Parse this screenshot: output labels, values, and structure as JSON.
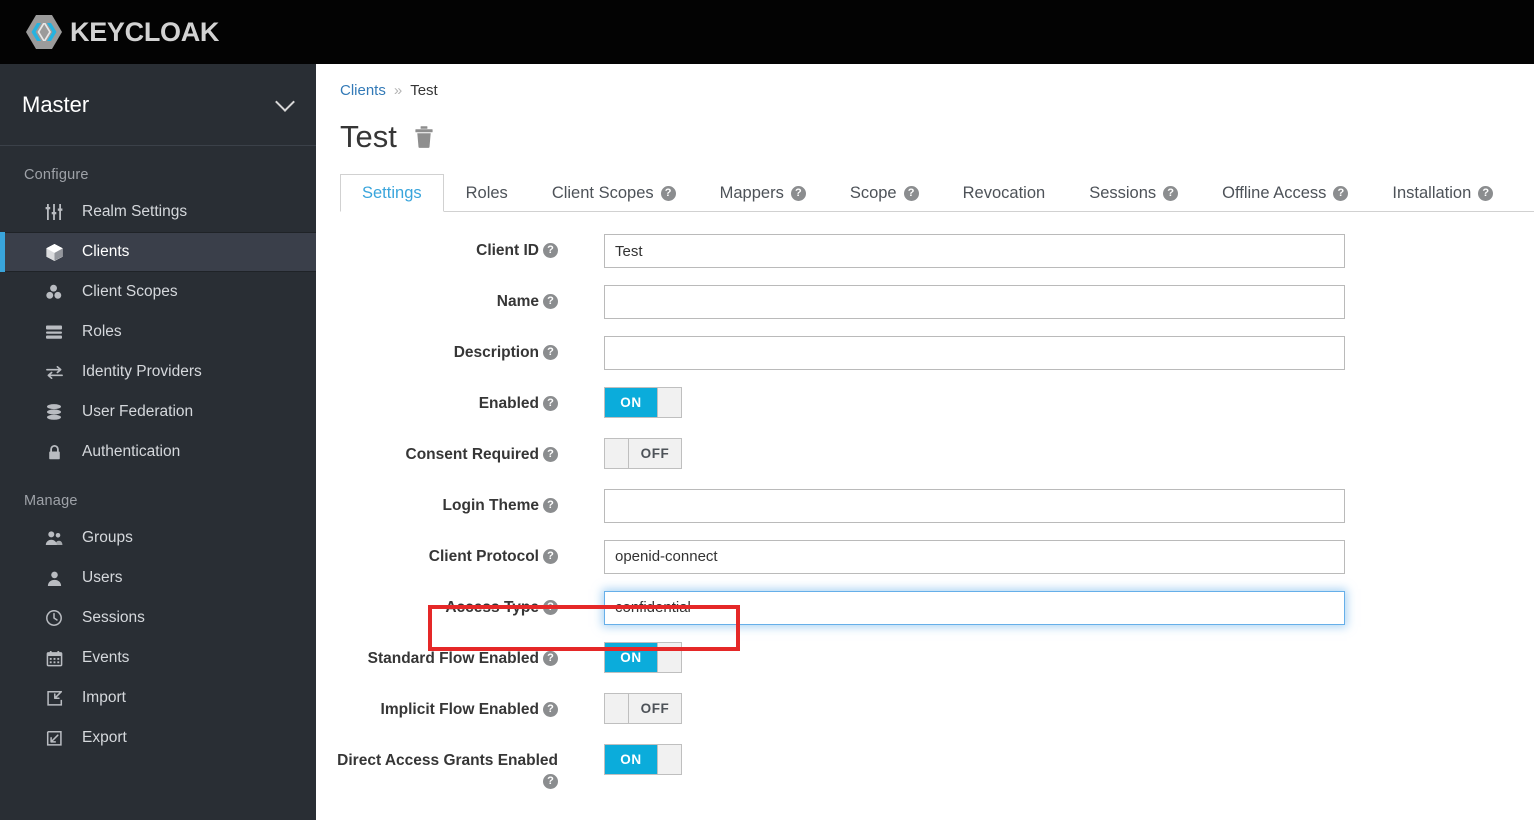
{
  "app": {
    "brand_name": "KEYCLOAK",
    "brand_icon": "keycloak-hexagon-logo",
    "accent_blue": "#39a5dc",
    "toggle_blue": "#0bacdb",
    "annotation_color": "#e52828"
  },
  "sidebar": {
    "realm": {
      "name": "Master",
      "chevron_icon": "chevron-down-icon"
    },
    "groups": [
      {
        "title": "Configure",
        "items": [
          {
            "label": "Realm Settings",
            "icon": "sliders-icon",
            "active": false
          },
          {
            "label": "Clients",
            "icon": "cube-icon",
            "active": true
          },
          {
            "label": "Client Scopes",
            "icon": "blocks-icon",
            "active": false
          },
          {
            "label": "Roles",
            "icon": "list-rows-icon",
            "active": false
          },
          {
            "label": "Identity Providers",
            "icon": "exchange-arrows-icon",
            "active": false
          },
          {
            "label": "User Federation",
            "icon": "database-icon",
            "active": false
          },
          {
            "label": "Authentication",
            "icon": "lock-icon",
            "active": false
          }
        ]
      },
      {
        "title": "Manage",
        "items": [
          {
            "label": "Groups",
            "icon": "users-group-icon",
            "active": false
          },
          {
            "label": "Users",
            "icon": "user-icon",
            "active": false
          },
          {
            "label": "Sessions",
            "icon": "clock-icon",
            "active": false
          },
          {
            "label": "Events",
            "icon": "calendar-icon",
            "active": false
          },
          {
            "label": "Import",
            "icon": "import-arrow-icon",
            "active": false
          },
          {
            "label": "Export",
            "icon": "export-arrow-icon",
            "active": false
          }
        ]
      }
    ]
  },
  "breadcrumb": {
    "parent": "Clients",
    "separator": "»",
    "current": "Test"
  },
  "page": {
    "title": "Test",
    "delete_icon": "trash-icon"
  },
  "tabs": [
    {
      "label": "Settings",
      "help": false,
      "active": true
    },
    {
      "label": "Roles",
      "help": false,
      "active": false
    },
    {
      "label": "Client Scopes",
      "help": true,
      "active": false
    },
    {
      "label": "Mappers",
      "help": true,
      "active": false
    },
    {
      "label": "Scope",
      "help": true,
      "active": false
    },
    {
      "label": "Revocation",
      "help": false,
      "active": false
    },
    {
      "label": "Sessions",
      "help": true,
      "active": false
    },
    {
      "label": "Offline Access",
      "help": true,
      "active": false
    },
    {
      "label": "Installation",
      "help": true,
      "active": false
    }
  ],
  "form": {
    "client_id": {
      "label": "Client ID",
      "value": "Test",
      "placeholder": ""
    },
    "name": {
      "label": "Name",
      "value": "",
      "placeholder": ""
    },
    "description": {
      "label": "Description",
      "value": "",
      "placeholder": ""
    },
    "enabled": {
      "label": "Enabled",
      "state": "ON"
    },
    "consent_required": {
      "label": "Consent Required",
      "state": "OFF"
    },
    "login_theme": {
      "label": "Login Theme",
      "value": ""
    },
    "client_protocol": {
      "label": "Client Protocol",
      "value": "openid-connect"
    },
    "access_type": {
      "label": "Access Type",
      "value": "confidential"
    },
    "standard_flow": {
      "label": "Standard Flow Enabled",
      "state": "ON"
    },
    "implicit_flow": {
      "label": "Implicit Flow Enabled",
      "state": "OFF"
    },
    "direct_access": {
      "label": "Direct Access Grants Enabled",
      "state": "ON"
    },
    "help_glyph": "?",
    "caret_icon": "chevron-down-icon"
  }
}
